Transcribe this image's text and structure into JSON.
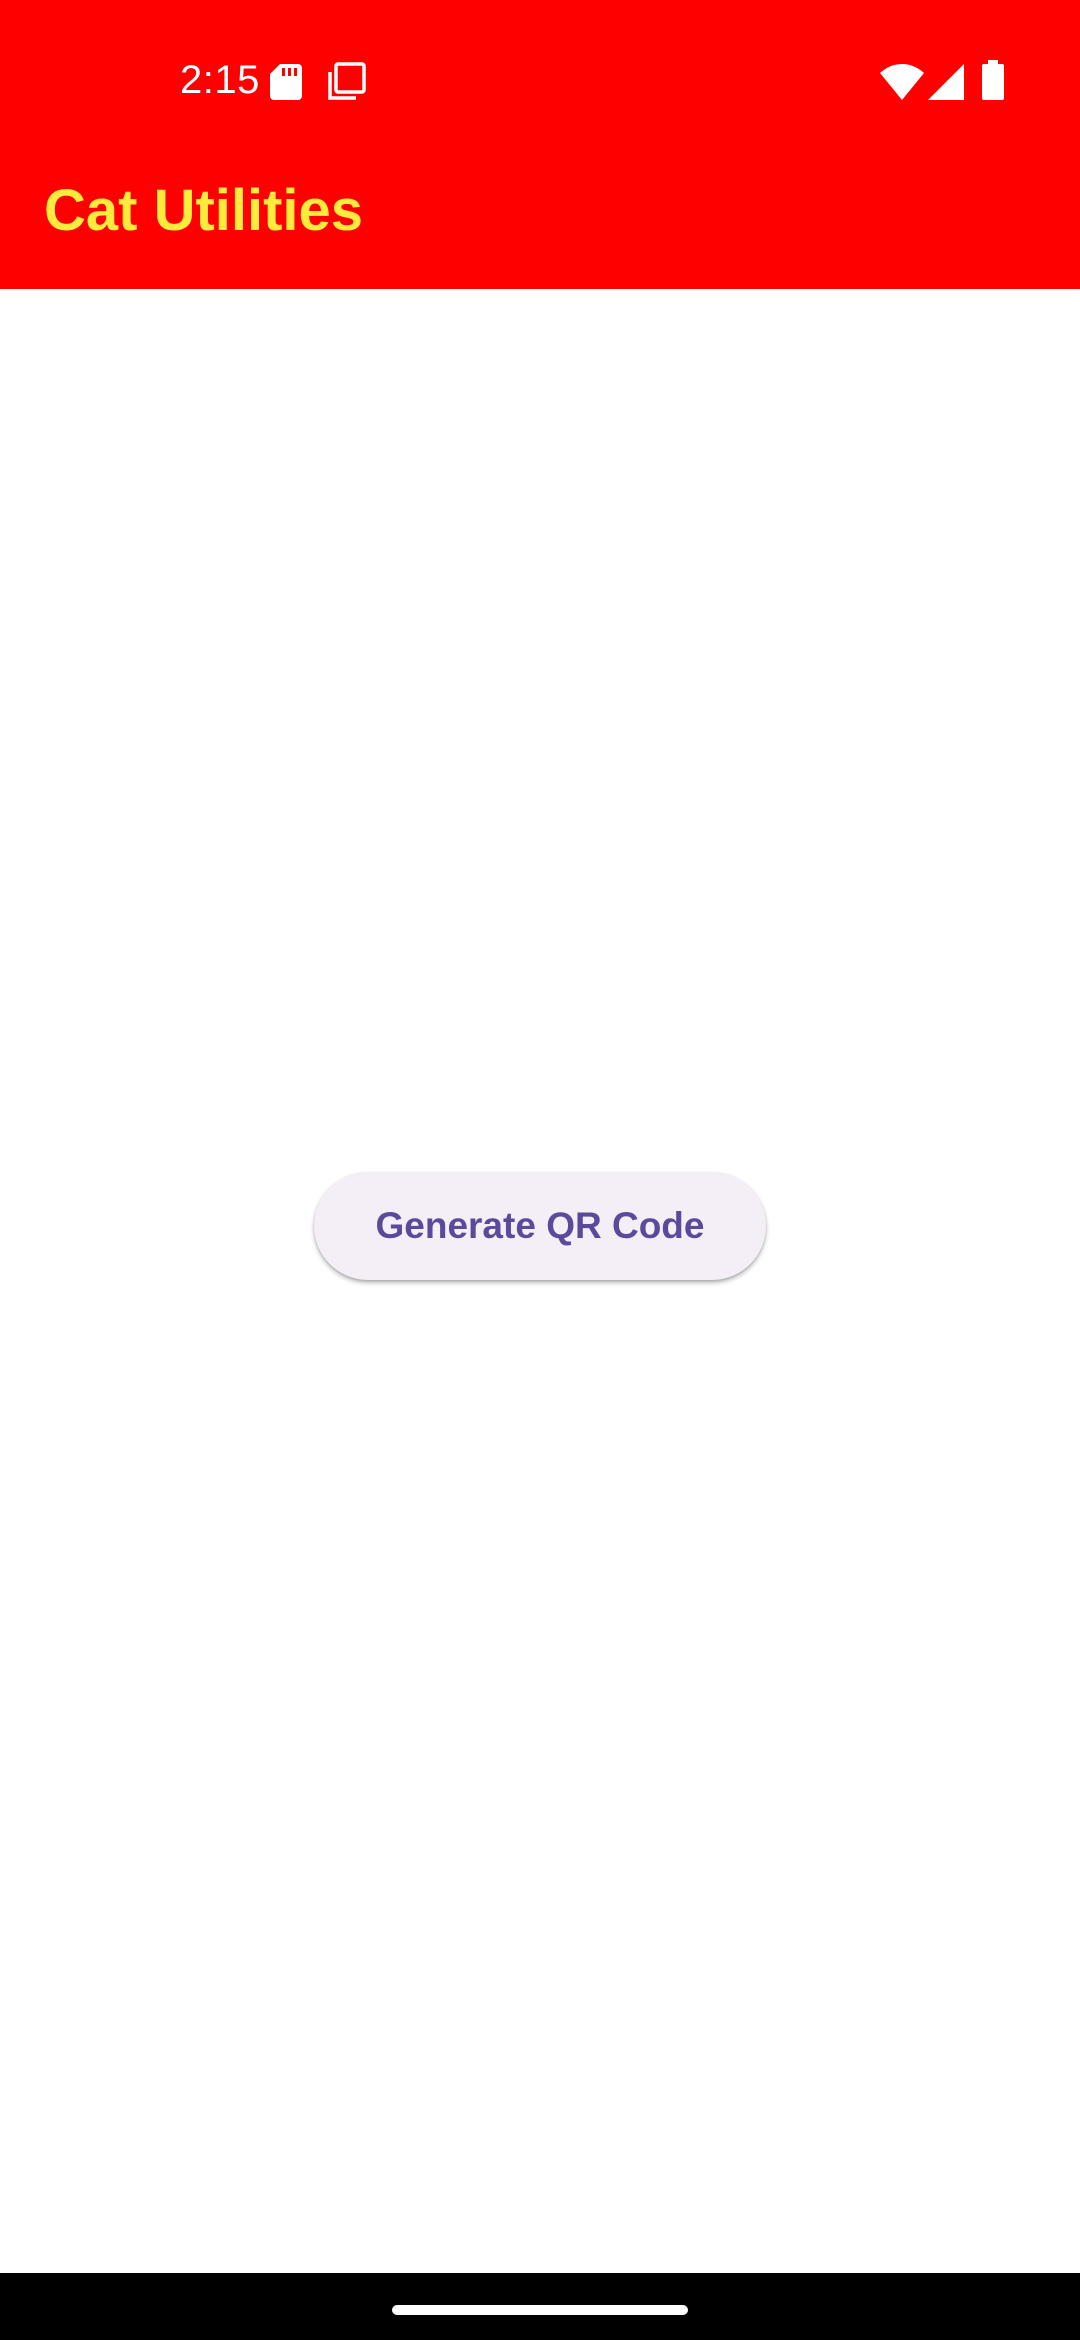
{
  "status_bar": {
    "time": "2:15",
    "icons": [
      "sd-card-icon",
      "copy-icon",
      "wifi-icon",
      "signal-icon",
      "battery-icon"
    ]
  },
  "app_bar": {
    "title": "Cat Utilities",
    "background_color": "#ff0000",
    "title_color": "#ffeb3b"
  },
  "main": {
    "generate_button_label": "Generate QR Code",
    "button_background": "#f4eff7",
    "button_text_color": "#5b4a9c"
  },
  "nav_bar": {
    "icons": [
      "home-indicator"
    ]
  }
}
